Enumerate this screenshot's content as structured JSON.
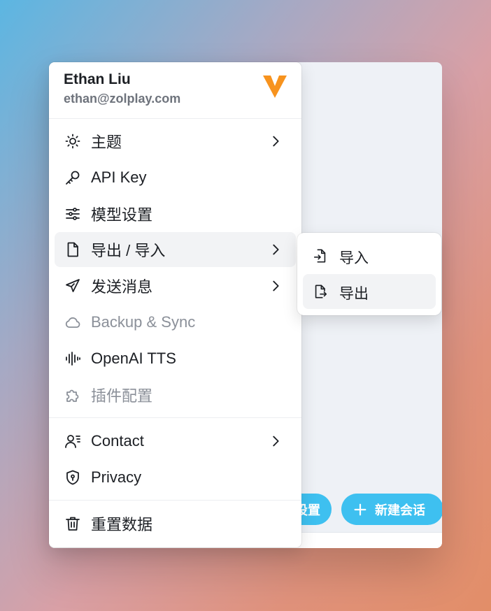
{
  "user": {
    "name": "Ethan Liu",
    "email": "ethan@zolplay.com",
    "logo_color": "#f7931e"
  },
  "menu": {
    "items": [
      {
        "label": "主题",
        "icon": "sun-icon",
        "submenu": true
      },
      {
        "label": "API Key",
        "icon": "key-icon",
        "submenu": false
      },
      {
        "label": "模型设置",
        "icon": "sliders-icon",
        "submenu": false
      },
      {
        "label": "导出 / 导入",
        "icon": "file-icon",
        "submenu": true,
        "active": true
      },
      {
        "label": "发送消息",
        "icon": "send-icon",
        "submenu": true
      },
      {
        "label": "Backup & Sync",
        "icon": "cloud-icon",
        "submenu": false,
        "disabled": true
      },
      {
        "label": "OpenAI TTS",
        "icon": "audio-wave-icon",
        "submenu": false
      },
      {
        "label": "插件配置",
        "icon": "puzzle-icon",
        "submenu": false,
        "disabled": true
      },
      {
        "label": "Contact",
        "icon": "user-contact-icon",
        "submenu": true
      },
      {
        "label": "Privacy",
        "icon": "shield-icon",
        "submenu": false
      },
      {
        "label": "重置数据",
        "icon": "trash-icon",
        "submenu": false
      }
    ]
  },
  "submenu": {
    "items": [
      {
        "label": "导入",
        "icon": "file-import-icon"
      },
      {
        "label": "导出",
        "icon": "file-export-icon",
        "active": true
      }
    ]
  },
  "background_buttons": {
    "settings_label": "设置",
    "new_chat_label": "新建会话"
  },
  "colors": {
    "accent": "#3ec0f0",
    "disabled_text": "#8b9099",
    "active_bg": "#f2f3f5"
  }
}
